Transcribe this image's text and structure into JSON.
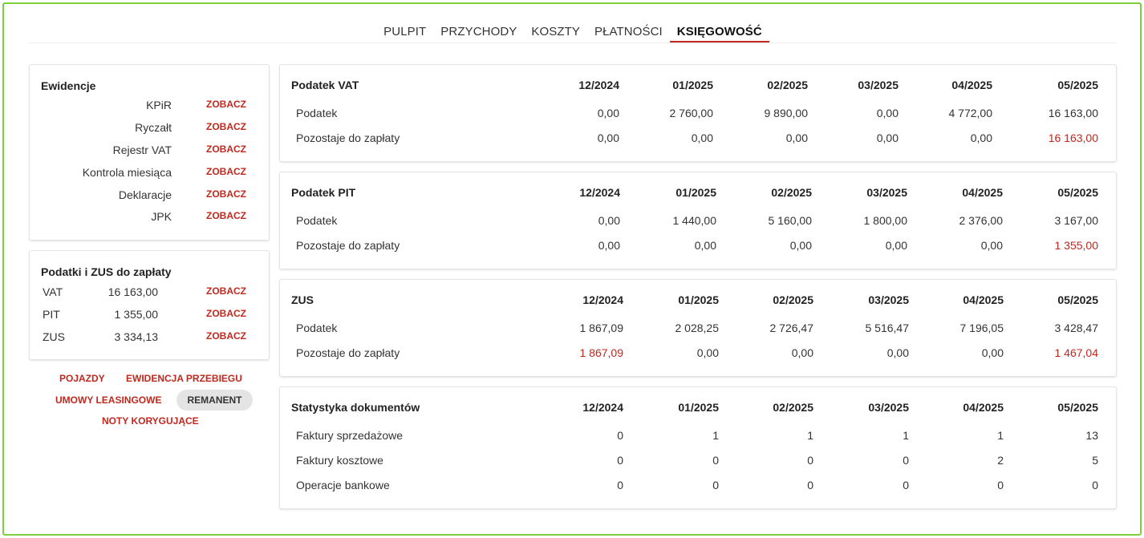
{
  "nav": {
    "tabs": [
      {
        "label": "PULPIT",
        "active": false
      },
      {
        "label": "PRZYCHODY",
        "active": false
      },
      {
        "label": "KOSZTY",
        "active": false
      },
      {
        "label": "PŁATNOŚCI",
        "active": false
      },
      {
        "label": "KSIĘGOWOŚĆ",
        "active": true
      }
    ]
  },
  "ewidencje": {
    "title": "Ewidencje",
    "link_label": "ZOBACZ",
    "items": [
      "KPiR",
      "Ryczałt",
      "Rejestr VAT",
      "Kontrola miesiąca",
      "Deklaracje",
      "JPK"
    ]
  },
  "podatki": {
    "title": "Podatki i ZUS do zapłaty",
    "link_label": "ZOBACZ",
    "items": [
      {
        "label": "VAT",
        "value": "16 163,00"
      },
      {
        "label": "PIT",
        "value": "1 355,00"
      },
      {
        "label": "ZUS",
        "value": "3 334,13"
      }
    ]
  },
  "bottom_links": {
    "pojazdy": "POJAZDY",
    "ewidencja_przebiegu": "EWIDENCJA PRZEBIEGU",
    "umowy_leasingowe": "UMOWY LEASINGOWE",
    "remanent": "REMANENT",
    "noty_korygujace": "NOTY KORYGUJĄCE"
  },
  "colors": {
    "accent": "#c0281e",
    "frame": "#7dcf3e"
  },
  "tables": [
    {
      "title": "Podatek VAT",
      "months": [
        "12/2024",
        "01/2025",
        "02/2025",
        "03/2025",
        "04/2025",
        "05/2025"
      ],
      "rows": [
        {
          "label": "Podatek",
          "values": [
            "0,00",
            "2 760,00",
            "9 890,00",
            "0,00",
            "4 772,00",
            "16 163,00"
          ],
          "red": [
            false,
            false,
            false,
            false,
            false,
            false
          ]
        },
        {
          "label": "Pozostaje do zapłaty",
          "values": [
            "0,00",
            "0,00",
            "0,00",
            "0,00",
            "0,00",
            "16 163,00"
          ],
          "red": [
            false,
            false,
            false,
            false,
            false,
            true
          ]
        }
      ]
    },
    {
      "title": "Podatek PIT",
      "months": [
        "12/2024",
        "01/2025",
        "02/2025",
        "03/2025",
        "04/2025",
        "05/2025"
      ],
      "rows": [
        {
          "label": "Podatek",
          "values": [
            "0,00",
            "1 440,00",
            "5 160,00",
            "1 800,00",
            "2 376,00",
            "3 167,00"
          ],
          "red": [
            false,
            false,
            false,
            false,
            false,
            false
          ]
        },
        {
          "label": "Pozostaje do zapłaty",
          "values": [
            "0,00",
            "0,00",
            "0,00",
            "0,00",
            "0,00",
            "1 355,00"
          ],
          "red": [
            false,
            false,
            false,
            false,
            false,
            true
          ]
        }
      ]
    },
    {
      "title": "ZUS",
      "months": [
        "12/2024",
        "01/2025",
        "02/2025",
        "03/2025",
        "04/2025",
        "05/2025"
      ],
      "rows": [
        {
          "label": "Podatek",
          "values": [
            "1 867,09",
            "2 028,25",
            "2 726,47",
            "5 516,47",
            "7 196,05",
            "3 428,47"
          ],
          "red": [
            false,
            false,
            false,
            false,
            false,
            false
          ]
        },
        {
          "label": "Pozostaje do zapłaty",
          "values": [
            "1 867,09",
            "0,00",
            "0,00",
            "0,00",
            "0,00",
            "1 467,04"
          ],
          "red": [
            true,
            false,
            false,
            false,
            false,
            true
          ]
        }
      ]
    },
    {
      "title": "Statystyka dokumentów",
      "months": [
        "12/2024",
        "01/2025",
        "02/2025",
        "03/2025",
        "04/2025",
        "05/2025"
      ],
      "rows": [
        {
          "label": "Faktury sprzedażowe",
          "values": [
            "0",
            "1",
            "1",
            "1",
            "1",
            "13"
          ],
          "red": [
            false,
            false,
            false,
            false,
            false,
            false
          ]
        },
        {
          "label": "Faktury kosztowe",
          "values": [
            "0",
            "0",
            "0",
            "0",
            "2",
            "5"
          ],
          "red": [
            false,
            false,
            false,
            false,
            false,
            false
          ]
        },
        {
          "label": "Operacje bankowe",
          "values": [
            "0",
            "0",
            "0",
            "0",
            "0",
            "0"
          ],
          "red": [
            false,
            false,
            false,
            false,
            false,
            false
          ]
        }
      ]
    }
  ]
}
